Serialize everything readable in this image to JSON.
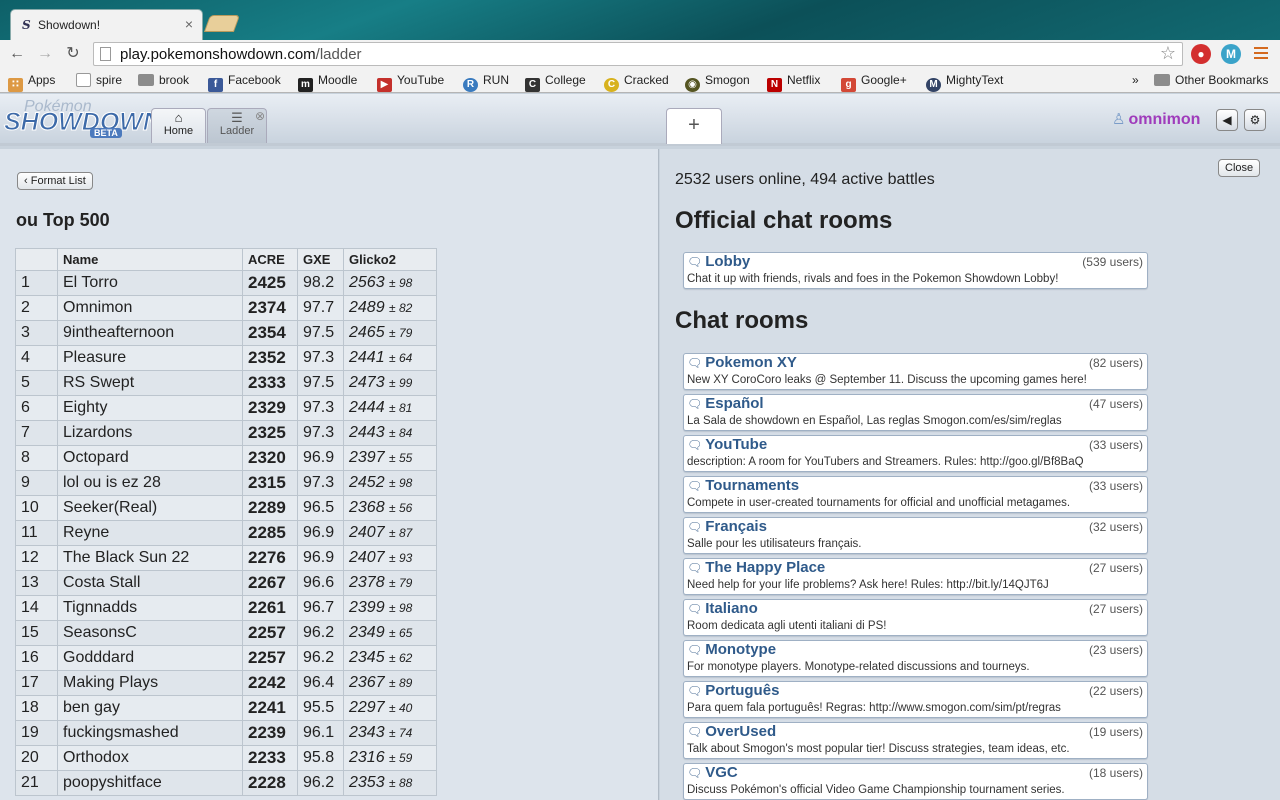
{
  "browser": {
    "tab_title": "Showdown!",
    "url_host": "play.pokemonshowdown.com",
    "url_path": "/ladder",
    "bookmarks": [
      {
        "label": "Apps",
        "icon": "apps-grid-icon",
        "color": "#d94"
      },
      {
        "label": "spire",
        "icon": "page-icon",
        "color": "#fff"
      },
      {
        "label": "brook",
        "icon": "folder-icon",
        "color": "#888"
      },
      {
        "label": "Facebook",
        "icon": "facebook-icon",
        "color": "#3b5998"
      },
      {
        "label": "Moodle",
        "icon": "moodle-icon",
        "color": "#222"
      },
      {
        "label": "YouTube",
        "icon": "youtube-icon",
        "color": "#c4302b"
      },
      {
        "label": "RUN",
        "icon": "run-icon",
        "color": "#3a7bbf"
      },
      {
        "label": "College",
        "icon": "college-icon",
        "color": "#333"
      },
      {
        "label": "Cracked",
        "icon": "cracked-icon",
        "color": "#d8b21e"
      },
      {
        "label": "Smogon",
        "icon": "smogon-icon",
        "color": "#552"
      },
      {
        "label": "Netflix",
        "icon": "netflix-icon",
        "color": "#b00"
      },
      {
        "label": "Google+",
        "icon": "google-plus-icon",
        "color": "#d34836"
      },
      {
        "label": "MightyText",
        "icon": "mightytext-icon",
        "color": "#346"
      }
    ],
    "other_bookmarks": "Other Bookmarks",
    "overflow": "»"
  },
  "app": {
    "logo_top": "Pokémon",
    "logo_main": "SHOWDOWN",
    "logo_badge": "BETA",
    "tabs": {
      "home": "Home",
      "ladder": "Ladder"
    },
    "username": "omnimon"
  },
  "ladder": {
    "format_list_button": "Format List",
    "title": "ou Top 500",
    "columns": [
      "",
      "Name",
      "ACRE",
      "GXE",
      "Glicko2"
    ],
    "rows": [
      {
        "rank": "1",
        "name": "El Torro",
        "acre": "2425",
        "gxe": "98.2",
        "glicko": "2563",
        "dev": "± 98"
      },
      {
        "rank": "2",
        "name": "Omnimon",
        "acre": "2374",
        "gxe": "97.7",
        "glicko": "2489",
        "dev": "± 82"
      },
      {
        "rank": "3",
        "name": "9intheafternoon",
        "acre": "2354",
        "gxe": "97.5",
        "glicko": "2465",
        "dev": "± 79"
      },
      {
        "rank": "4",
        "name": "Pleasure",
        "acre": "2352",
        "gxe": "97.3",
        "glicko": "2441",
        "dev": "± 64"
      },
      {
        "rank": "5",
        "name": "RS Swept",
        "acre": "2333",
        "gxe": "97.5",
        "glicko": "2473",
        "dev": "± 99"
      },
      {
        "rank": "6",
        "name": "Eighty",
        "acre": "2329",
        "gxe": "97.3",
        "glicko": "2444",
        "dev": "± 81"
      },
      {
        "rank": "7",
        "name": "Lizardons",
        "acre": "2325",
        "gxe": "97.3",
        "glicko": "2443",
        "dev": "± 84"
      },
      {
        "rank": "8",
        "name": "Octopard",
        "acre": "2320",
        "gxe": "96.9",
        "glicko": "2397",
        "dev": "± 55"
      },
      {
        "rank": "9",
        "name": "lol ou is ez 28",
        "acre": "2315",
        "gxe": "97.3",
        "glicko": "2452",
        "dev": "± 98"
      },
      {
        "rank": "10",
        "name": "Seeker(Real)",
        "acre": "2289",
        "gxe": "96.5",
        "glicko": "2368",
        "dev": "± 56"
      },
      {
        "rank": "11",
        "name": "Reyne",
        "acre": "2285",
        "gxe": "96.9",
        "glicko": "2407",
        "dev": "± 87"
      },
      {
        "rank": "12",
        "name": "The Black Sun 22",
        "acre": "2276",
        "gxe": "96.9",
        "glicko": "2407",
        "dev": "± 93"
      },
      {
        "rank": "13",
        "name": "Costa Stall",
        "acre": "2267",
        "gxe": "96.6",
        "glicko": "2378",
        "dev": "± 79"
      },
      {
        "rank": "14",
        "name": "Tignnadds",
        "acre": "2261",
        "gxe": "96.7",
        "glicko": "2399",
        "dev": "± 98"
      },
      {
        "rank": "15",
        "name": "SeasonsC",
        "acre": "2257",
        "gxe": "96.2",
        "glicko": "2349",
        "dev": "± 65"
      },
      {
        "rank": "16",
        "name": "Godddard",
        "acre": "2257",
        "gxe": "96.2",
        "glicko": "2345",
        "dev": "± 62"
      },
      {
        "rank": "17",
        "name": "Making Plays",
        "acre": "2242",
        "gxe": "96.4",
        "glicko": "2367",
        "dev": "± 89"
      },
      {
        "rank": "18",
        "name": "ben gay",
        "acre": "2241",
        "gxe": "95.5",
        "glicko": "2297",
        "dev": "± 40"
      },
      {
        "rank": "19",
        "name": "fuckingsmashed",
        "acre": "2239",
        "gxe": "96.1",
        "glicko": "2343",
        "dev": "± 74"
      },
      {
        "rank": "20",
        "name": "Orthodox",
        "acre": "2233",
        "gxe": "95.8",
        "glicko": "2316",
        "dev": "± 59"
      },
      {
        "rank": "21",
        "name": "poopyshitface",
        "acre": "2228",
        "gxe": "96.2",
        "glicko": "2353",
        "dev": "± 88"
      }
    ]
  },
  "lobby": {
    "close_button": "Close",
    "stats": "2532 users online, 494 active battles",
    "official_heading": "Official chat rooms",
    "official_rooms": [
      {
        "name": "Lobby",
        "users": "(539 users)",
        "desc": "Chat it up with friends, rivals and foes in the Pokemon Showdown Lobby!"
      }
    ],
    "chat_heading": "Chat rooms",
    "rooms": [
      {
        "name": "Pokemon XY",
        "users": "(82 users)",
        "desc": "New XY CoroCoro leaks @ September 11. Discuss the upcoming games here!"
      },
      {
        "name": "Español",
        "users": "(47 users)",
        "desc": "La Sala de showdown en Español, Las reglas Smogon.com/es/sim/reglas"
      },
      {
        "name": "YouTube",
        "users": "(33 users)",
        "desc": "description: A room for YouTubers and Streamers. Rules: http://goo.gl/Bf8BaQ"
      },
      {
        "name": "Tournaments",
        "users": "(33 users)",
        "desc": "Compete in user-created tournaments for official and unofficial metagames."
      },
      {
        "name": "Français",
        "users": "(32 users)",
        "desc": "Salle pour les utilisateurs français."
      },
      {
        "name": "The Happy Place",
        "users": "(27 users)",
        "desc": "Need help for your life problems? Ask here! Rules: http://bit.ly/14QJT6J"
      },
      {
        "name": "Italiano",
        "users": "(27 users)",
        "desc": "Room dedicata agli utenti italiani di PS!"
      },
      {
        "name": "Monotype",
        "users": "(23 users)",
        "desc": "For monotype players. Monotype-related discussions and tourneys."
      },
      {
        "name": "Português",
        "users": "(22 users)",
        "desc": "Para quem fala português! Regras: http://www.smogon.com/sim/pt/regras"
      },
      {
        "name": "OverUsed",
        "users": "(19 users)",
        "desc": "Talk about Smogon's most popular tier! Discuss strategies, team ideas, etc."
      },
      {
        "name": "VGC",
        "users": "(18 users)",
        "desc": "Discuss Pokémon's official Video Game Championship tournament series."
      }
    ]
  }
}
